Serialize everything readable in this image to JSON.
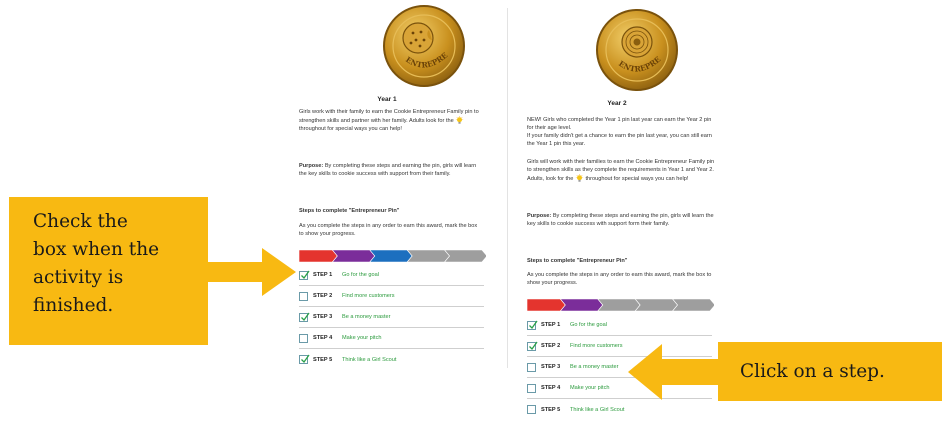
{
  "colors": {
    "gold": "#c9901e",
    "callout": "#f8b912",
    "step_link": "#2a9a3c",
    "progress": [
      "#e4342e",
      "#7b2d9a",
      "#1c6fbf",
      "#9e9e9e",
      "#9e9e9e"
    ]
  },
  "left_panel": {
    "badge_icon": "cookie-pin-icon",
    "badge_text": "ENTREPRENEUR",
    "title": "Year 1",
    "intro": "Girls work with their family to earn the Cookie Entrepreneur Family pin to strengthen skills and partner with her family. Adults look for the",
    "intro_end": "throughout for special ways you can help!",
    "purpose_label": "Purpose:",
    "purpose_text": "By completing these steps and earning the pin, girls will learn the key skills to cookie success with support from their family.",
    "steps_heading": "Steps to complete \"Entrepreneur Pin\"",
    "steps_intro": "As you complete the steps in any order to earn this award, mark the box to show your progress.",
    "progress_filled": 3,
    "progress_total": 5,
    "steps": [
      {
        "num": "STEP 1",
        "name": "Go for the goal",
        "checked": true
      },
      {
        "num": "STEP 2",
        "name": "Find more customers",
        "checked": false
      },
      {
        "num": "STEP 3",
        "name": "Be a money master",
        "checked": true
      },
      {
        "num": "STEP 4",
        "name": "Make your pitch",
        "checked": false
      },
      {
        "num": "STEP 5",
        "name": "Think like a Girl Scout",
        "checked": true
      }
    ]
  },
  "right_panel": {
    "badge_icon": "donut-pin-icon",
    "badge_text": "ENTREPRENEUR",
    "title": "Year 2",
    "intro1": "NEW! Girls who completed the Year 1 pin last year can earn the Year 2 pin for their age level.",
    "intro2": "If your family didn't get a chance to earn the pin last year, you can still earn the Year 1 pin this year.",
    "intro3": "Girls will work with their families to earn the Cookie Entrepreneur Family pin to strengthen skills as they complete the requirements in Year 1 and Year 2. Adults, look for the",
    "intro3_end": "throughout for special ways you can help!",
    "purpose_label": "Purpose:",
    "purpose_text": "By completing these steps and earning the pin, girls will learn the key skills to cookie success with support form their family.",
    "steps_heading": "Steps to complete \"Entrepreneur Pin\"",
    "steps_intro": "As you complete the steps in any order to earn this award, mark the box to show your progress.",
    "progress_filled": 2,
    "progress_total": 5,
    "steps": [
      {
        "num": "STEP 1",
        "name": "Go for the goal",
        "checked": true
      },
      {
        "num": "STEP 2",
        "name": "Find more customers",
        "checked": true
      },
      {
        "num": "STEP 3",
        "name": "Be a money master",
        "checked": false
      },
      {
        "num": "STEP 4",
        "name": "Make your pitch",
        "checked": false
      },
      {
        "num": "STEP 5",
        "name": "Think like a Girl Scout",
        "checked": false
      }
    ]
  },
  "callouts": {
    "left": [
      "Check the",
      "box when the",
      "activity is",
      "finished."
    ],
    "right": "Click on a step."
  }
}
